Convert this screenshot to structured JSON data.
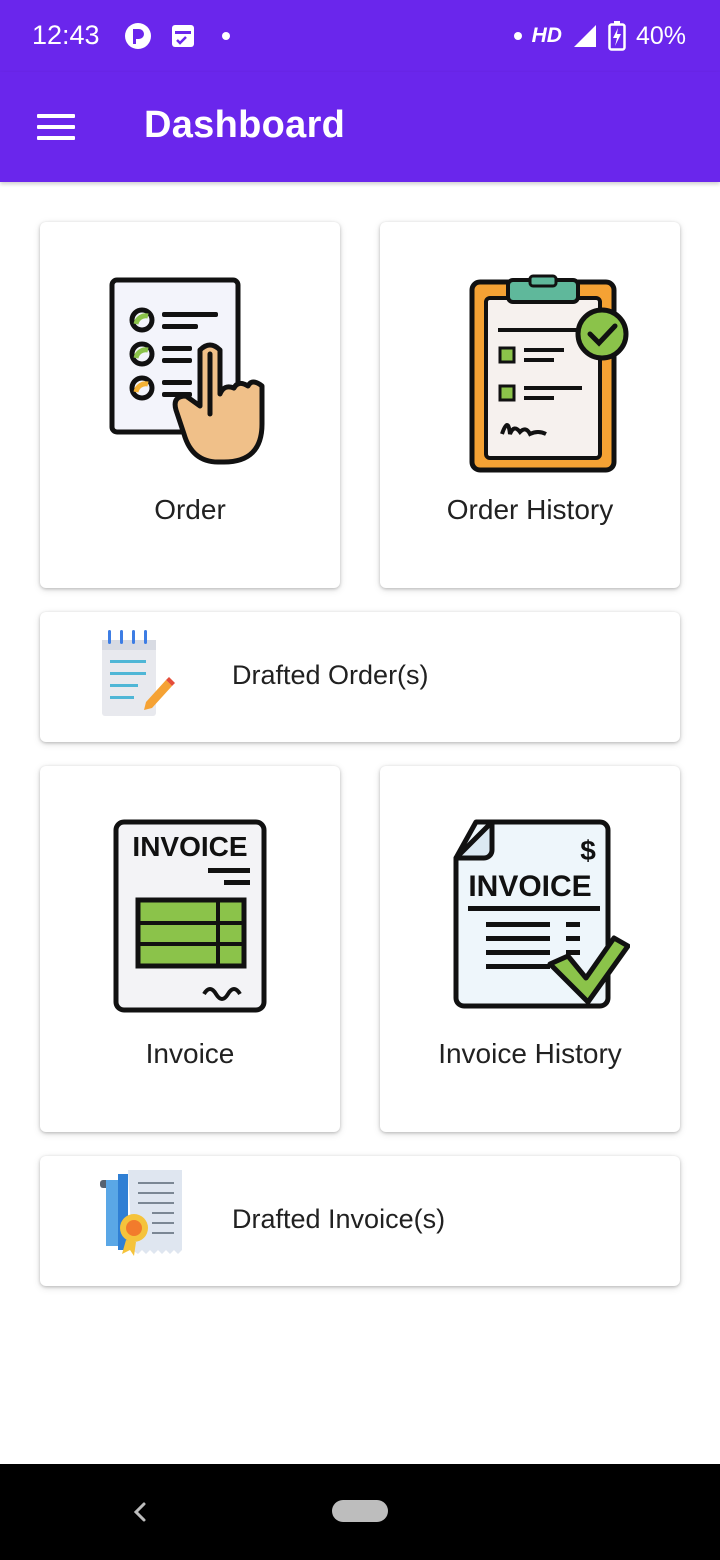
{
  "status_bar": {
    "time": "12:43",
    "network": "HD",
    "battery": "40%"
  },
  "app_bar": {
    "title": "Dashboard",
    "menu_icon": "hamburger-menu-icon"
  },
  "cards": {
    "order": {
      "label": "Order",
      "icon": "order-checklist-touch-icon"
    },
    "order_history": {
      "label": "Order History",
      "icon": "clipboard-check-icon"
    },
    "drafted_orders": {
      "label": "Drafted Order(s)",
      "icon": "notepad-pencil-icon"
    },
    "invoice": {
      "label": "Invoice",
      "icon": "invoice-icon"
    },
    "invoice_history": {
      "label": "Invoice History",
      "icon": "invoice-check-icon"
    },
    "drafted_invoices": {
      "label": "Drafted Invoice(s)",
      "icon": "certificate-scroll-icon"
    }
  },
  "icon_texts": {
    "invoice": "INVOICE",
    "dollar": "$"
  },
  "colors": {
    "primary": "#6a26ec",
    "green": "#8bc34a",
    "orange": "#f5a234"
  }
}
